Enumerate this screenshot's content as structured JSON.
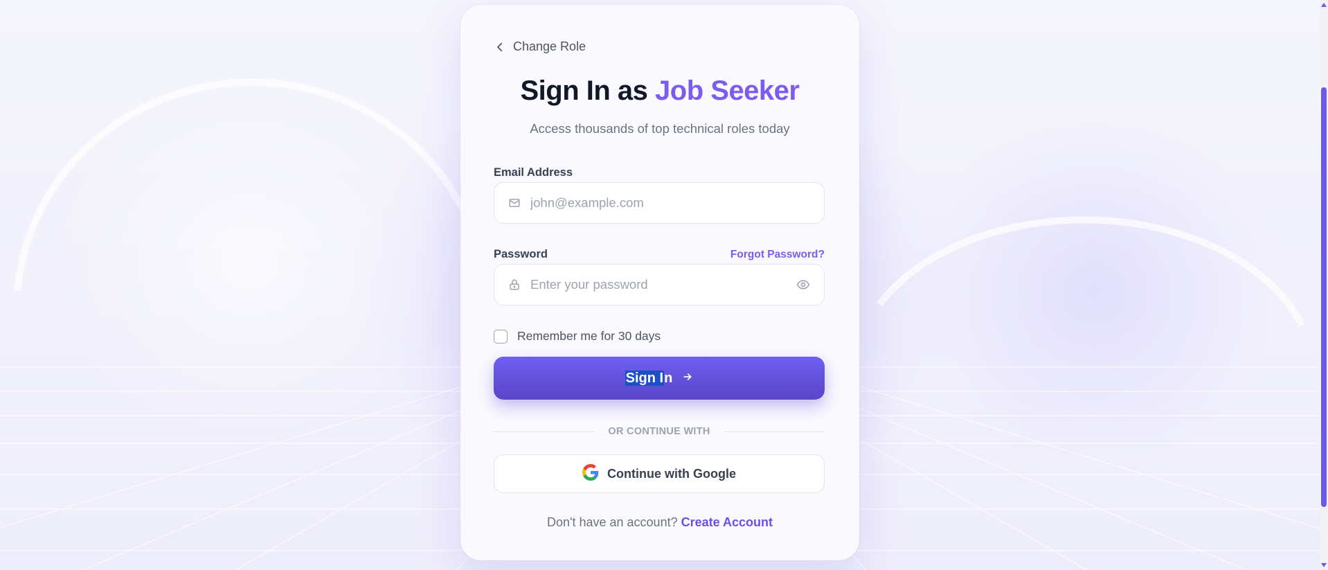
{
  "nav": {
    "back_label": "Change Role"
  },
  "header": {
    "title_prefix": "Sign In as ",
    "title_accent": "Job Seeker",
    "subtitle": "Access thousands of top technical roles today"
  },
  "form": {
    "email_label": "Email Address",
    "email_placeholder": "john@example.com",
    "password_label": "Password",
    "password_placeholder": "Enter your password",
    "forgot_label": "Forgot Password?",
    "remember_label": "Remember me for 30 days",
    "remember_checked": false,
    "signin_selected_text": "Sign I",
    "signin_rest_text": "n"
  },
  "divider": {
    "text": "OR CONTINUE WITH"
  },
  "social": {
    "google_label": "Continue with Google"
  },
  "footer": {
    "prompt": "Don't have an account? ",
    "link_label": "Create Account"
  },
  "colors": {
    "accent": "#7c5cf0",
    "button_top": "#6f5ff1",
    "button_bottom": "#5a45c8",
    "title": "#111827",
    "muted": "#6b7280"
  },
  "icons": {
    "back": "chevron-left-icon",
    "email": "mail-icon",
    "password": "lock-icon",
    "toggle": "eye-icon",
    "signin": "arrow-right-icon",
    "google": "google-logo-icon"
  }
}
